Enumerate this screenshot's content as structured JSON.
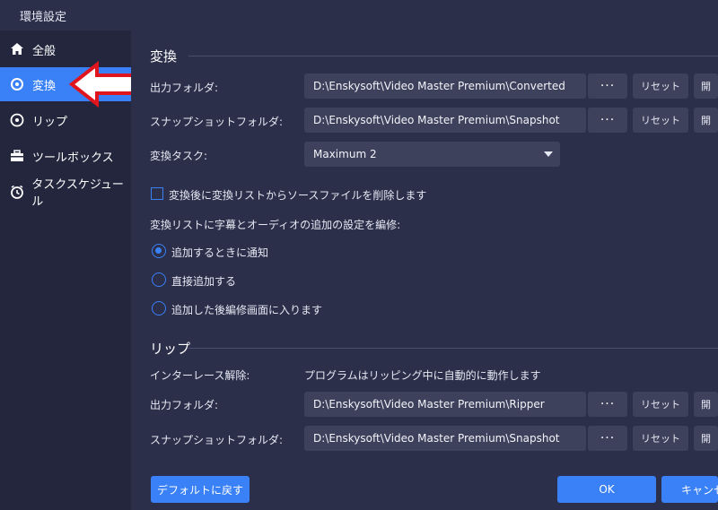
{
  "window": {
    "title": "環境設定"
  },
  "sidebar": {
    "items": [
      {
        "label": "全般",
        "icon": "home-icon"
      },
      {
        "label": "変換",
        "icon": "convert-icon",
        "active": true
      },
      {
        "label": "リップ",
        "icon": "rip-icon"
      },
      {
        "label": "ツールボックス",
        "icon": "toolbox-icon"
      },
      {
        "label": "タスクスケジュール",
        "icon": "clock-icon"
      }
    ]
  },
  "convert": {
    "title": "変換",
    "output_folder_label": "出力フォルダ:",
    "output_folder_value": "D:\\Enskysoft\\Video Master Premium\\Converted",
    "snapshot_folder_label": "スナップショットフォルダ:",
    "snapshot_folder_value": "D:\\Enskysoft\\Video Master Premium\\Snapshot",
    "task_label": "変換タスク:",
    "task_value": "Maximum 2",
    "delete_source_label": "変換後に変換リストからソースファイルを削除します",
    "delete_source_checked": false,
    "subtitle_label": "変換リストに字幕とオーディオの追加の設定を編修:",
    "radio_options": [
      {
        "label": "追加するときに通知",
        "selected": true
      },
      {
        "label": "直接追加する",
        "selected": false
      },
      {
        "label": "追加した後編修画面に入ります",
        "selected": false
      }
    ]
  },
  "rip": {
    "title": "リップ",
    "deinterlace_label": "インターレース解除:",
    "deinterlace_value": "プログラムはリッピング中に自動的に動作します",
    "output_folder_label": "出力フォルダ:",
    "output_folder_value": "D:\\Enskysoft\\Video Master Premium\\Ripper",
    "snapshot_folder_label": "スナップショットフォルダ:",
    "snapshot_folder_value": "D:\\Enskysoft\\Video Master Premium\\Snapshot"
  },
  "buttons": {
    "dots": "···",
    "reset": "リセット",
    "open_cut": "開",
    "default": "デフォルトに戻す",
    "ok": "OK",
    "cancel": "キャンセル"
  },
  "colors": {
    "accent": "#3a80f6",
    "arrow": "#e0161e"
  }
}
